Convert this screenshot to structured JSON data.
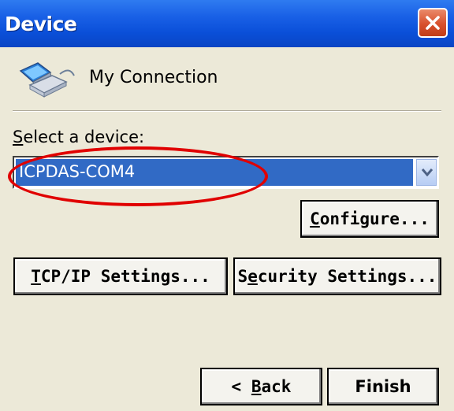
{
  "window": {
    "title": "Device"
  },
  "connection": {
    "label": "My Connection",
    "icon": "network-computer-icon"
  },
  "device_select": {
    "label_mnemonic": "S",
    "label_rest": "elect a device:",
    "selected_value": "ICPDAS-COM4",
    "selection_color": "#316ac5"
  },
  "buttons": {
    "configure": {
      "mnemonic": "C",
      "rest": "onfigure..."
    },
    "tcpip": {
      "mnemonic": "T",
      "rest": "CP/IP Settings..."
    },
    "security": {
      "prefix": "S",
      "mnemonic": "e",
      "rest": "curity Settings..."
    },
    "back": {
      "prefix": "< ",
      "mnemonic": "B",
      "rest": "ack"
    },
    "finish": {
      "label": "Finish"
    }
  },
  "annotation": {
    "color": "#e00000"
  }
}
